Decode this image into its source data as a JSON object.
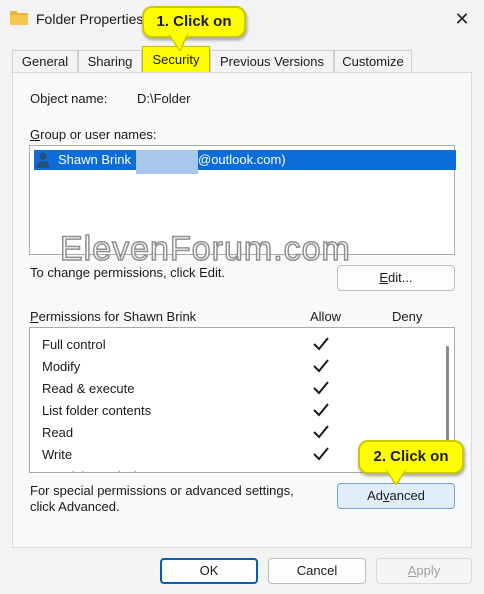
{
  "window": {
    "title": "Folder Properties"
  },
  "tabs": [
    {
      "label": "General"
    },
    {
      "label": "Sharing"
    },
    {
      "label": "Security"
    },
    {
      "label": "Previous Versions"
    },
    {
      "label": "Customize"
    }
  ],
  "security": {
    "object_name_label": "Object name:",
    "object_name_value": "D:\\Folder",
    "group_label": "Group or user names:",
    "users": [
      {
        "name": "Shawn Brink",
        "email_suffix": "@outlook.com)"
      }
    ],
    "change_text": "To change permissions, click Edit.",
    "edit_button": "Edit...",
    "permissions_label": "Permissions for Shawn Brink",
    "allow_header": "Allow",
    "deny_header": "Deny",
    "permissions": [
      {
        "label": "Full control",
        "allow": true,
        "deny": false
      },
      {
        "label": "Modify",
        "allow": true,
        "deny": false
      },
      {
        "label": "Read & execute",
        "allow": true,
        "deny": false
      },
      {
        "label": "List folder contents",
        "allow": true,
        "deny": false
      },
      {
        "label": "Read",
        "allow": true,
        "deny": false
      },
      {
        "label": "Write",
        "allow": true,
        "deny": false
      }
    ],
    "special_text_line1": "For special permissions or advanced settings,",
    "special_text_line2": "click Advanced.",
    "advanced_button": "Advanced"
  },
  "footer": {
    "ok": "OK",
    "cancel": "Cancel",
    "apply": "Apply"
  },
  "callouts": [
    {
      "text": "1. Click on"
    },
    {
      "text": "2. Click on"
    }
  ],
  "watermark": "ElevenForum.com",
  "colors": {
    "selection": "#0d6dd8",
    "callout": "#ffff00",
    "primary_border": "#005fb8"
  }
}
